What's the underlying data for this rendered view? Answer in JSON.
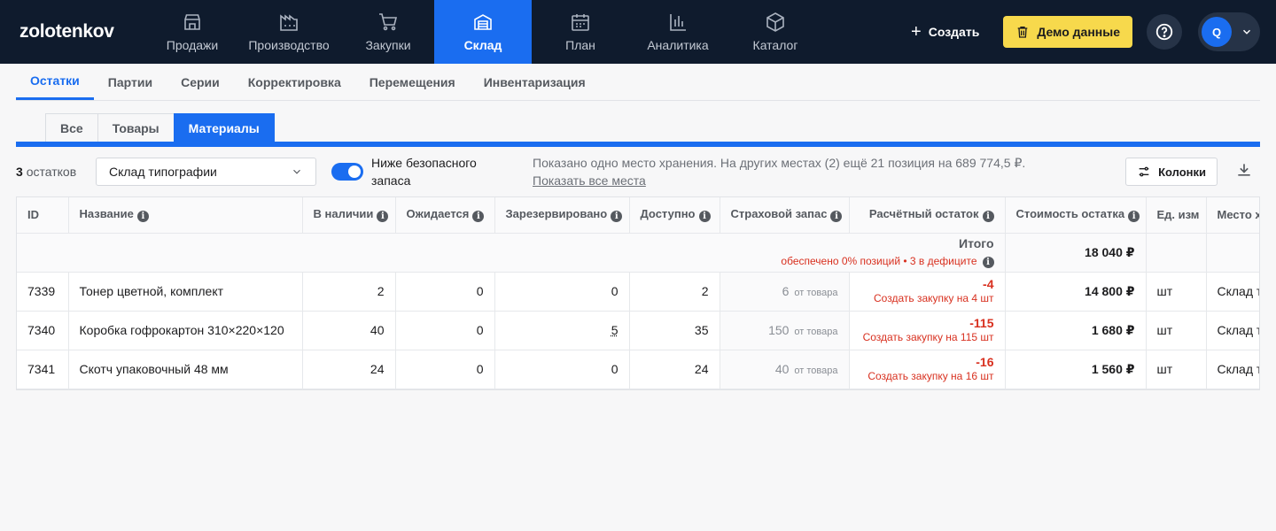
{
  "app": {
    "logo": "zolotenkov"
  },
  "nav": {
    "items": [
      {
        "label": "Продажи",
        "icon": "store-icon"
      },
      {
        "label": "Производство",
        "icon": "factory-icon"
      },
      {
        "label": "Закупки",
        "icon": "cart-icon"
      },
      {
        "label": "Склад",
        "icon": "warehouse-icon",
        "active": true
      },
      {
        "label": "План",
        "icon": "calendar-icon"
      },
      {
        "label": "Аналитика",
        "icon": "chart-icon"
      },
      {
        "label": "Каталог",
        "icon": "box-icon"
      }
    ],
    "create_label": "Создать",
    "demo_label": "Демо данные",
    "avatar_letter": "Q"
  },
  "subtabs": [
    "Остатки",
    "Партии",
    "Серии",
    "Корректировка",
    "Перемещения",
    "Инвентаризация"
  ],
  "filter_tabs": [
    "Все",
    "Товары",
    "Материалы"
  ],
  "toolbar": {
    "count_num": "3",
    "count_text": "остатков",
    "warehouse": "Склад типографии",
    "toggle_label": "Ниже безопасного запаса",
    "info": "Показано одно место хранения. На других местах (2) ещё 21 позиция на 689 774,5 ₽.",
    "show_all": "Показать все места",
    "columns_label": "Колонки"
  },
  "table": {
    "headers": [
      "ID",
      "Название",
      "В наличии",
      "Ожидается",
      "Зарезервировано",
      "Доступно",
      "Страховой запас",
      "Расчётный остаток",
      "Стоимость остатка",
      "Ед. изм",
      "Место хранения"
    ],
    "total_label": "Итого",
    "total_sub": "обеспечено 0% позиций • 3 в дефиците",
    "total_sum": "18 040 ₽",
    "ss_unit": "от товара",
    "rows": [
      {
        "id": "7339",
        "name": "Тонер цветной, комплект",
        "stock": "2",
        "expected": "0",
        "reserved": "0",
        "available": "2",
        "safety": "6",
        "calc": "-4",
        "action": "Создать закупку на 4 шт",
        "cost": "14 800 ₽",
        "unit": "шт",
        "place": "Склад типографии"
      },
      {
        "id": "7340",
        "name": "Коробка гофрокартон 310×220×120",
        "stock": "40",
        "expected": "0",
        "reserved": "5",
        "available": "35",
        "safety": "150",
        "calc": "-115",
        "action": "Создать закупку на 115 шт",
        "cost": "1 680 ₽",
        "unit": "шт",
        "place": "Склад типографии"
      },
      {
        "id": "7341",
        "name": "Скотч упаковочный 48 мм",
        "stock": "24",
        "expected": "0",
        "reserved": "0",
        "available": "24",
        "safety": "40",
        "calc": "-16",
        "action": "Создать закупку на 16 шт",
        "cost": "1 560 ₽",
        "unit": "шт",
        "place": "Склад типографии"
      }
    ]
  },
  "colors": {
    "accent": "#1a6df0",
    "nav_bg": "#0f1b2d",
    "deficit": "#d8301f",
    "demo": "#f7d94c"
  }
}
